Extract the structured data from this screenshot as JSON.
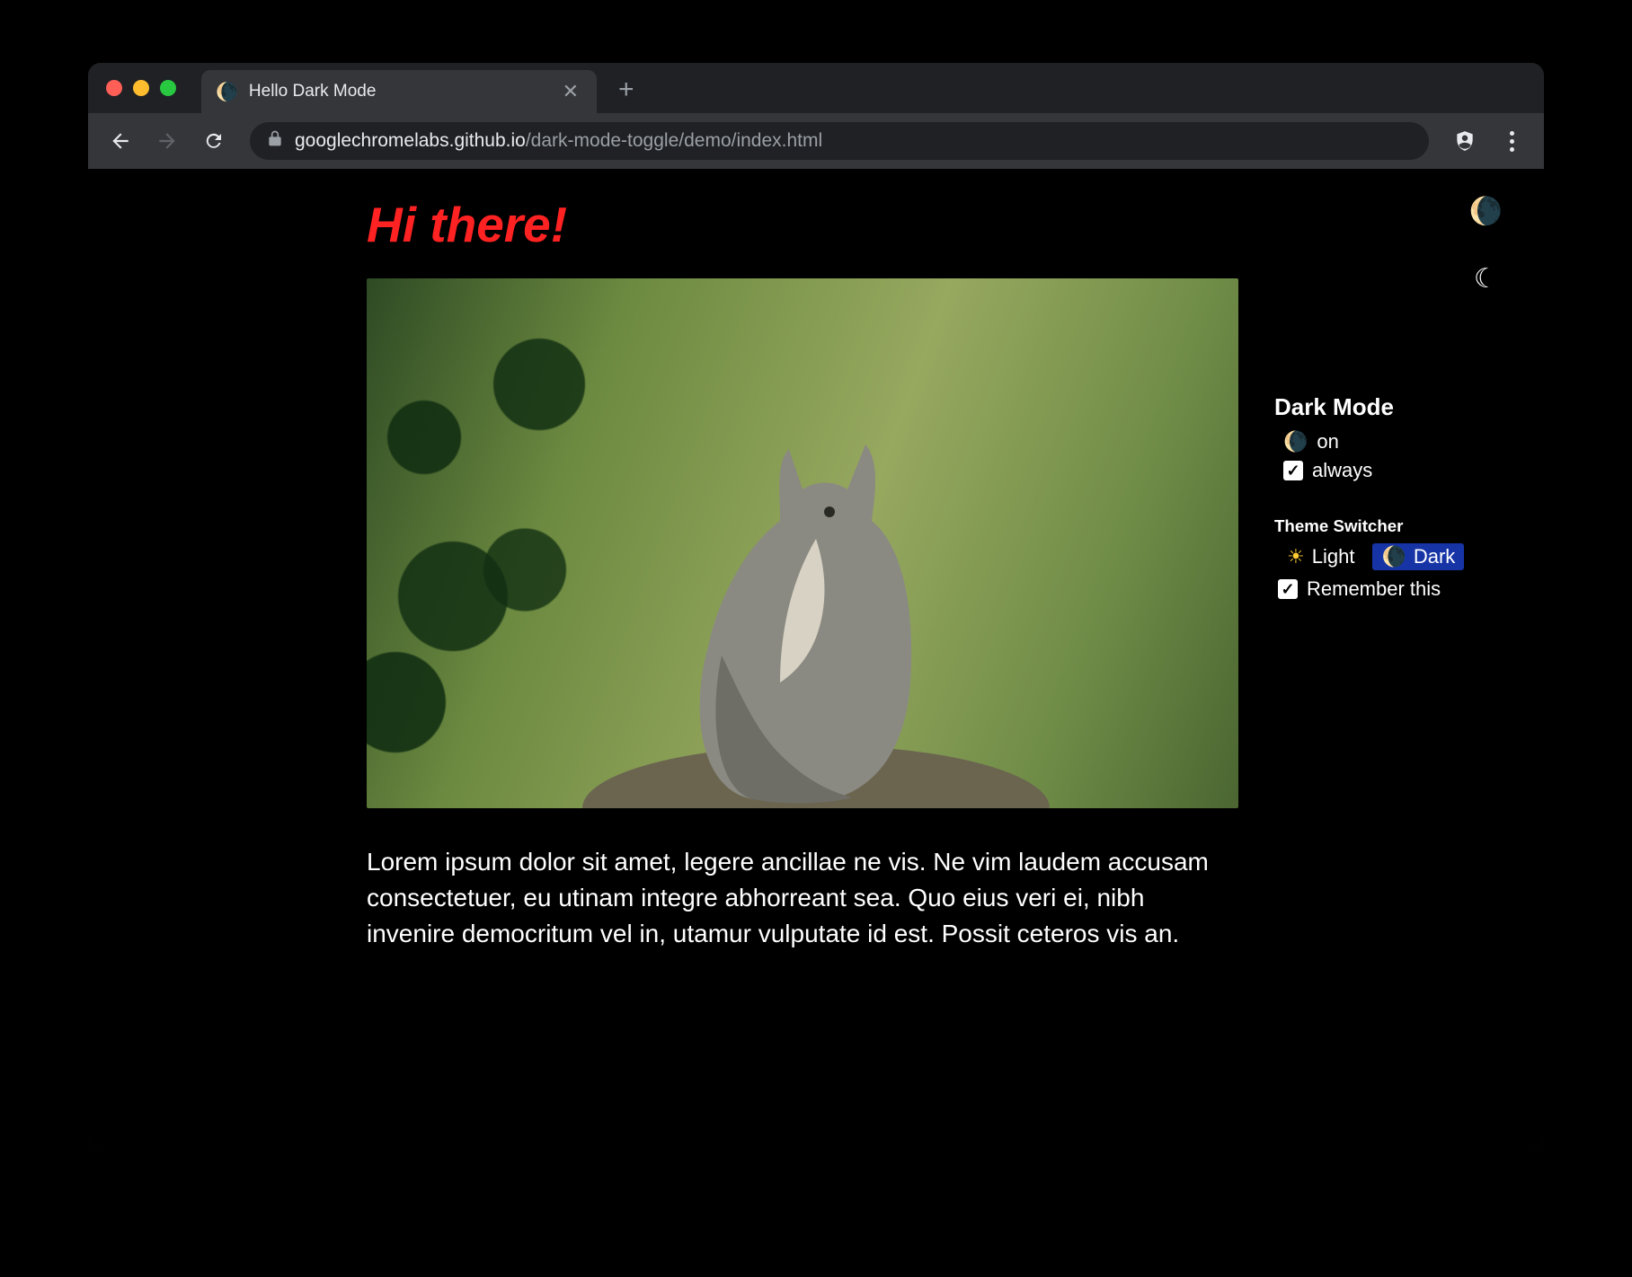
{
  "tab": {
    "favicon": "🌘",
    "title": "Hello Dark Mode"
  },
  "url": {
    "host": "googlechromelabs.github.io",
    "path": "/dark-mode-toggle/demo/index.html"
  },
  "page": {
    "heading": "Hi there!",
    "body": "Lorem ipsum dolor sit amet, legere ancillae ne vis. Ne vim laudem accusam consectetuer, eu utinam integre abhorreant sea. Quo eius veri ei, nibh invenire democritum vel in, utamur vulputate id est. Possit ceteros vis an."
  },
  "darkmode": {
    "title": "Dark Mode",
    "state_label": "on",
    "always_label": "always",
    "always_checked": true
  },
  "switcher": {
    "title": "Theme Switcher",
    "light_label": "Light",
    "dark_label": "Dark",
    "remember_label": "Remember this",
    "remember_checked": true
  },
  "icons": {
    "moon": "🌘",
    "sun": "☀",
    "crescent_white": "☾"
  }
}
